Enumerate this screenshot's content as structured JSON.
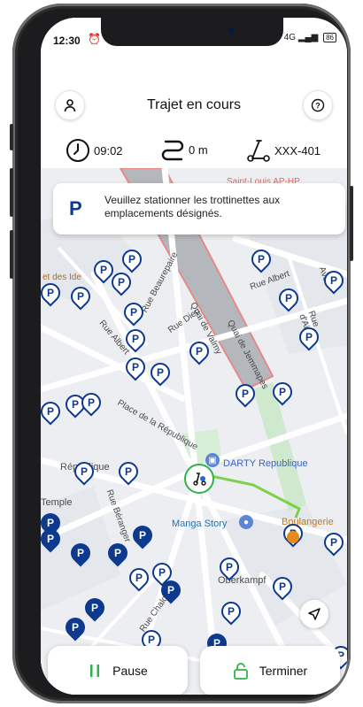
{
  "status_bar": {
    "time": "12:30",
    "network": "4G",
    "battery": "86"
  },
  "header": {
    "title": "Trajet en cours"
  },
  "stats": {
    "duration": "09:02",
    "distance": "0 m",
    "vehicle_id": "XXX-401"
  },
  "banner": {
    "icon_letter": "P",
    "message": "Veuillez stationner les trottinettes aux emplacements désignés."
  },
  "map": {
    "parking_letter": "P",
    "labels": {
      "place": "Place de la République",
      "quai_valmy": "Quai de Valmy",
      "quai_jemmapes": "Quai de Jemmapes",
      "rue_beaurepaire": "Rue Beaurepaire",
      "rue_dieu": "Rue Dieu",
      "rue_albert": "Rue Albert",
      "rue_albert2": "Rue Albert",
      "rue_beranger": "Rue Béranger",
      "rue_chalot": "Rue Chalot",
      "saint_louis": "Saint-Louis AP-HP",
      "darty": "DARTY Republique",
      "manga": "Manga Story",
      "boulangerie": "Boulangerie",
      "overkampf": "Oberkampf",
      "republique": "République",
      "temple": "Temple",
      "ide": "et des Ide",
      "ave": "Ave",
      "rue_aix": "Rue d'Aix"
    }
  },
  "actions": {
    "pause_label": "Pause",
    "finish_label": "Terminer"
  },
  "colors": {
    "brand_blue": "#0d3a8f",
    "green": "#2db34a",
    "route": "#7dd14a"
  }
}
